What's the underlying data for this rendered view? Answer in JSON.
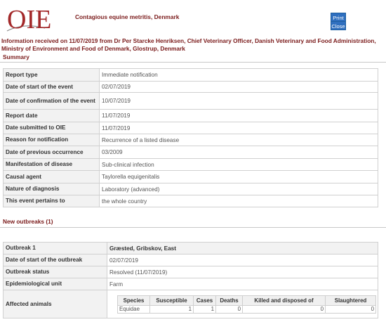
{
  "header": {
    "logo_text": "OIE",
    "disease_title": "Contagious equine metritis, Denmark",
    "print_label": "Print",
    "close_label": "Close"
  },
  "info_line": "Information received on 11/07/2019 from Dr Per Starcke Henriksen, Chief Veterinary Officer, Danish Veterinary and Food Administration, Ministry of Environment and Food of Denmark, Glostrup, Denmark",
  "summary": {
    "title": "Summary",
    "rows": [
      {
        "label": "Report type",
        "value": "Immediate notification"
      },
      {
        "label": "Date of start of the event",
        "value": "02/07/2019"
      },
      {
        "label": "Date of confirmation of the event",
        "value": "10/07/2019"
      },
      {
        "label": "Report date",
        "value": "11/07/2019"
      },
      {
        "label": "Date submitted to OIE",
        "value": "11/07/2019"
      },
      {
        "label": "Reason for notification",
        "value": "Recurrence of a listed disease"
      },
      {
        "label": "Date of previous occurrence",
        "value": "03/2009"
      },
      {
        "label": "Manifestation of disease",
        "value": "Sub-clinical infection"
      },
      {
        "label": "Causal agent",
        "value": "Taylorella equigenitalis"
      },
      {
        "label": "Nature of diagnosis",
        "value": "Laboratory (advanced)"
      },
      {
        "label": "This event pertains to",
        "value": "the whole country"
      }
    ]
  },
  "outbreaks": {
    "title": "New outbreaks (1)",
    "outbreak_label": "Outbreak 1",
    "outbreak_location": "Græsted, Gribskov, East",
    "rows": [
      {
        "label": "Date of start of the outbreak",
        "value": "02/07/2019"
      },
      {
        "label": "Outbreak status",
        "value": "Resolved (11/07/2019)"
      },
      {
        "label": "Epidemiological unit",
        "value": "Farm"
      }
    ],
    "affected_label": "Affected animals",
    "animals": {
      "headers": [
        "Species",
        "Susceptible",
        "Cases",
        "Deaths",
        "Killed and disposed of",
        "Slaughtered"
      ],
      "rows": [
        {
          "species": "Equidae",
          "susceptible": "1",
          "cases": "1",
          "deaths": "0",
          "killed": "0",
          "slaughtered": "0"
        }
      ]
    }
  }
}
